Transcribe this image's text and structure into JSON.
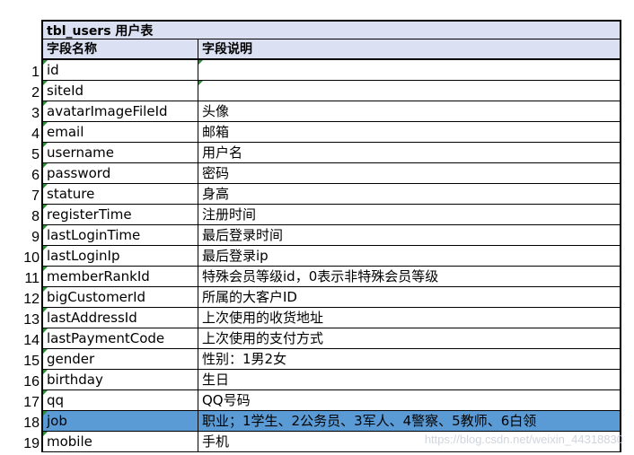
{
  "sheet": {
    "title": "tbl_users 用户表",
    "headers": [
      "字段名称",
      "字段说明"
    ],
    "rows": [
      {
        "num": "1",
        "field": "id",
        "desc": ""
      },
      {
        "num": "2",
        "field": "siteId",
        "desc": ""
      },
      {
        "num": "3",
        "field": "avatarImageFileId",
        "desc": "头像"
      },
      {
        "num": "4",
        "field": "email",
        "desc": "邮箱"
      },
      {
        "num": "5",
        "field": "username",
        "desc": "用户名"
      },
      {
        "num": "6",
        "field": "password",
        "desc": "密码"
      },
      {
        "num": "7",
        "field": "stature",
        "desc": "身高"
      },
      {
        "num": "8",
        "field": "registerTime",
        "desc": "注册时间"
      },
      {
        "num": "9",
        "field": "lastLoginTime",
        "desc": "最后登录时间"
      },
      {
        "num": "10",
        "field": "lastLoginIp",
        "desc": "最后登录ip"
      },
      {
        "num": "11",
        "field": "memberRankId",
        "desc": "特殊会员等级id，0表示非特殊会员等级"
      },
      {
        "num": "12",
        "field": "bigCustomerId",
        "desc": "所属的大客户ID"
      },
      {
        "num": "13",
        "field": "lastAddressId",
        "desc": "上次使用的收货地址"
      },
      {
        "num": "14",
        "field": "lastPaymentCode",
        "desc": "上次使用的支付方式"
      },
      {
        "num": "15",
        "field": "gender",
        "desc": "性别：1男2女"
      },
      {
        "num": "16",
        "field": "birthday",
        "desc": "生日"
      },
      {
        "num": "17",
        "field": "qq",
        "desc": "QQ号码"
      },
      {
        "num": "18",
        "field": "job",
        "desc": "职业；1学生、2公务员、3军人、4警察、5教师、6白领",
        "selected": true
      },
      {
        "num": "19",
        "field": "mobile",
        "desc": "手机"
      }
    ]
  },
  "watermark": "https://blog.csdn.net/weixin_44318830",
  "colors": {
    "header_bg": "#dbe1f3",
    "selected_bg": "#5b9bd5",
    "marker": "#2e8b3a"
  }
}
